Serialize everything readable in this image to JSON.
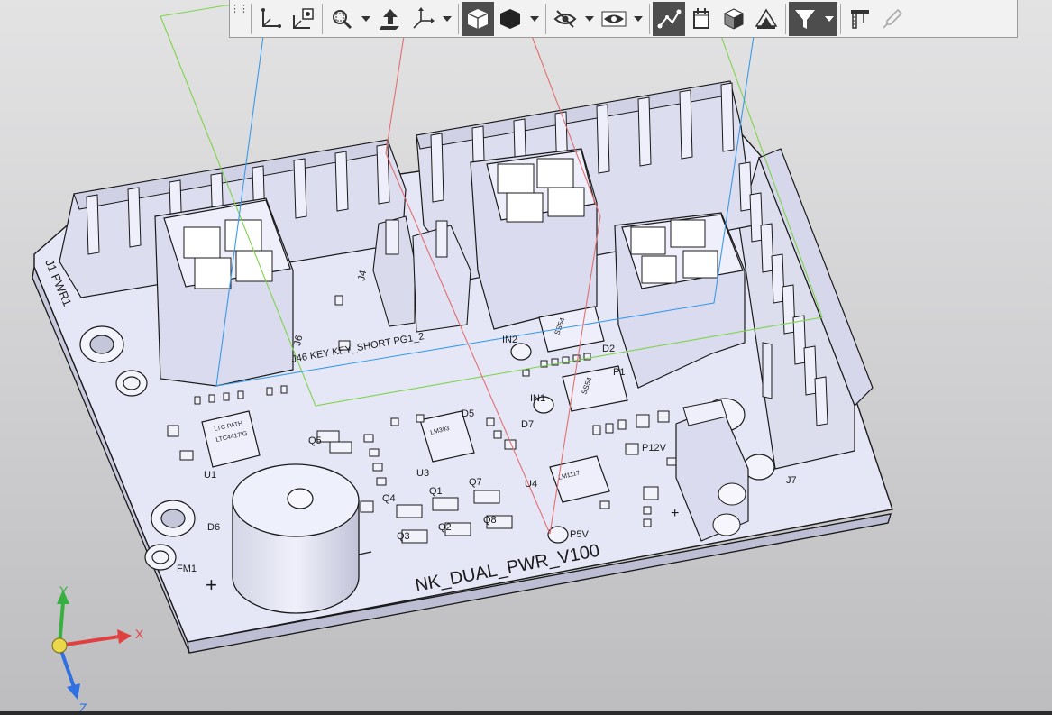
{
  "board": {
    "title": "NK_DUAL_PWR_V100",
    "labels": {
      "j1": "J1 PWR1",
      "j6": "J6",
      "j4": "J4",
      "header_row": "J46  KEY  KEY_SHORT  PG1_2",
      "in2": "IN2",
      "in1": "IN1",
      "d2": "D2",
      "p1": "P1",
      "d5": "D5",
      "d7": "D7",
      "u3": "U3",
      "u4": "U4",
      "u1": "U1",
      "d6": "D6",
      "fm1": "FM1",
      "q5": "Q5",
      "q4": "Q4",
      "q1": "Q1",
      "q7": "Q7",
      "q2": "Q2",
      "q3": "Q3",
      "q8": "Q8",
      "p12v": "P12V",
      "p5v": "P5V",
      "j7": "J7",
      "ic_u1": "LTC  PATH",
      "ic_u1b": "LTC4417IG",
      "ic_u3": "LM393",
      "ic_u4": "LM1117",
      "ic_ss54": "SS54",
      "plus": "+"
    }
  },
  "axes": {
    "x": "X",
    "y": "Y",
    "z": "Z",
    "x_color": "#e04040",
    "y_color": "#38b040",
    "z_color": "#3070e0"
  },
  "toolbar": {
    "grip": "⋮⋮",
    "buttons": [
      {
        "name": "sketch-plane-icon",
        "dark": false
      },
      {
        "name": "sketch-on-face-icon",
        "dark": false
      },
      {
        "name": "zoom-window-icon",
        "dark": false
      },
      {
        "name": "orient-view-icon",
        "dark": false
      },
      {
        "name": "axis-triad-icon",
        "dark": false
      },
      {
        "name": "shaded-with-edges-icon",
        "dark": true
      },
      {
        "name": "shaded-icon",
        "dark": false
      },
      {
        "name": "hide-icon",
        "dark": false
      },
      {
        "name": "show-hidden-icon",
        "dark": false
      },
      {
        "name": "sketch-relations-icon",
        "dark": true
      },
      {
        "name": "section-view-icon",
        "dark": false
      },
      {
        "name": "appearance-icon",
        "dark": false
      },
      {
        "name": "decals-icon",
        "dark": false
      },
      {
        "name": "filter-icon",
        "dark": true
      },
      {
        "name": "measure-icon",
        "dark": false
      },
      {
        "name": "eyedropper-icon",
        "dark": false
      }
    ],
    "colors": {
      "bar": "#f2f2f2",
      "active": "#4d4d4d"
    }
  },
  "colors": {
    "board_top": "#e6e7f6",
    "board_side": "#c8c9dc",
    "edge": "#1a1a1a",
    "plane_green": "#7ed34a",
    "plane_blue": "#3a9ae8",
    "plane_red": "#e07070"
  }
}
